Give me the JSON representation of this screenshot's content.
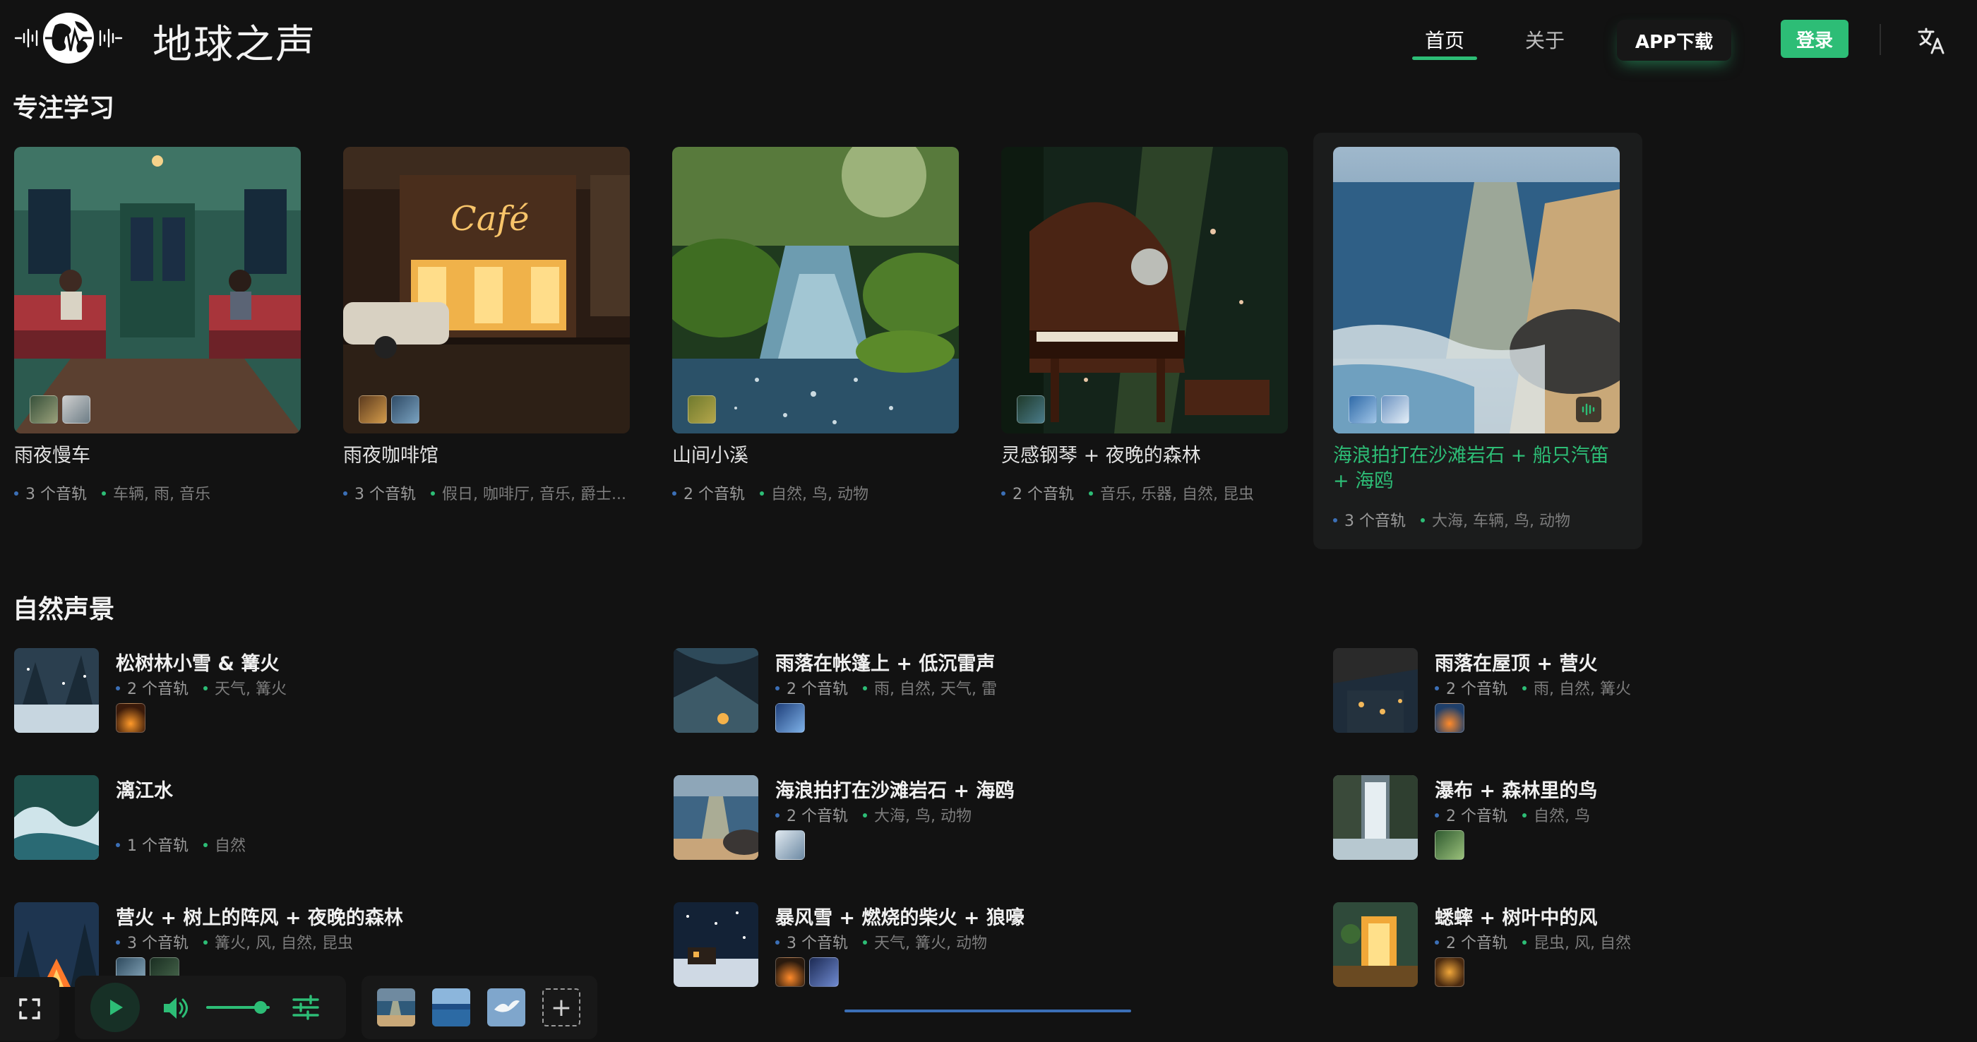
{
  "header": {
    "brand": "地球之声",
    "nav": {
      "home": "首页",
      "about": "关于"
    },
    "app_download": "APP下载",
    "login": "登录",
    "logo_icon": "earth-soundwave-logo",
    "language_icon": "translate-icon"
  },
  "focus": {
    "title": "专注学习",
    "cards": [
      {
        "name": "雨夜慢车",
        "tracks": "3 个音轨",
        "tags": "车辆, 雨, 音乐",
        "scene": "train"
      },
      {
        "name": "雨夜咖啡馆",
        "tracks": "3 个音轨",
        "tags": "假日, 咖啡厅, 音乐, 爵士...",
        "scene": "cafe"
      },
      {
        "name": "山间小溪",
        "tracks": "2 个音轨",
        "tags": "自然, 鸟, 动物",
        "scene": "creek"
      },
      {
        "name": "灵感钢琴 + 夜晚的森林",
        "tracks": "2 个音轨",
        "tags": "音乐, 乐器, 自然, 昆虫",
        "scene": "piano"
      },
      {
        "name": "海浪拍打在沙滩岩石 + 船只汽笛 + 海鸥",
        "tracks": "3 个音轨",
        "tags": "大海, 车辆, 鸟, 动物",
        "scene": "beach",
        "active": true
      }
    ]
  },
  "nature": {
    "title": "自然声景",
    "items": [
      {
        "name": "松树林小雪 & 篝火",
        "tracks": "2 个音轨",
        "tags": "天气, 篝火"
      },
      {
        "name": "雨落在帐篷上 + 低沉雷声",
        "tracks": "2 个音轨",
        "tags": "雨, 自然, 天气, 雷"
      },
      {
        "name": "雨落在屋顶 + 营火",
        "tracks": "2 个音轨",
        "tags": "雨, 自然, 篝火"
      },
      {
        "name": "漓江水",
        "tracks": "1 个音轨",
        "tags": "自然"
      },
      {
        "name": "海浪拍打在沙滩岩石 + 海鸥",
        "tracks": "2 个音轨",
        "tags": "大海, 鸟, 动物"
      },
      {
        "name": "瀑布 + 森林里的鸟",
        "tracks": "2 个音轨",
        "tags": "自然, 鸟"
      },
      {
        "name": "营火 + 树上的阵风 + 夜晚的森林",
        "tracks": "3 个音轨",
        "tags": "篝火, 风, 自然, 昆虫"
      },
      {
        "name": "暴风雪 + 燃烧的柴火 + 狼嚎",
        "tracks": "3 个音轨",
        "tags": "天气, 篝火, 动物"
      },
      {
        "name": "蟋蟀 + 树叶中的风",
        "tracks": "2 个音轨",
        "tags": "昆虫, 风, 自然"
      }
    ]
  },
  "player": {
    "volume_level": 0.85,
    "icons": [
      "fullscreen-icon",
      "play-icon",
      "volume-icon",
      "mixer-icon"
    ],
    "add_label": "+"
  },
  "colors": {
    "accent": "#2dbd76",
    "background": "#121212",
    "dot_blue": "#3b6fb6"
  }
}
